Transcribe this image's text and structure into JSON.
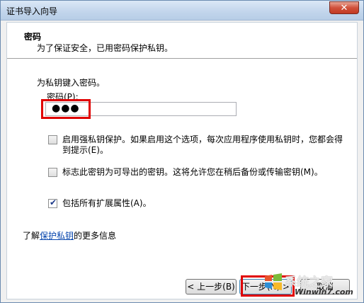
{
  "window": {
    "title": "证书导入向导",
    "close_label": "✕"
  },
  "header": {
    "title": "密码",
    "subtitle": "为了保证安全，已用密码保护私钥。"
  },
  "form": {
    "prompt": "为私钥键入密码。",
    "password_label": "密码(P):",
    "password_value": "●●●"
  },
  "options": [
    {
      "label": "启用强私钥保护。如果启用这个选项，每次应用程序使用私钥时，您都会得到提示(E)。",
      "checked": false
    },
    {
      "label": "标志此密钥为可导出的密钥。这将允许您在稍后备份或传输密钥(M)。",
      "checked": false
    },
    {
      "label": "包括所有扩展属性(A)。",
      "checked": true
    }
  ],
  "more_info": {
    "prefix": "了解",
    "link": "保护私钥",
    "suffix": "的更多信息"
  },
  "buttons": {
    "back": "< 上一步(B)",
    "next": "下一步(N) >",
    "cancel": "取消"
  },
  "watermark": {
    "top": "系统之家",
    "bottom": "Winwin7.com"
  },
  "colors": {
    "highlight": "#e00000",
    "link": "#0645ad"
  }
}
